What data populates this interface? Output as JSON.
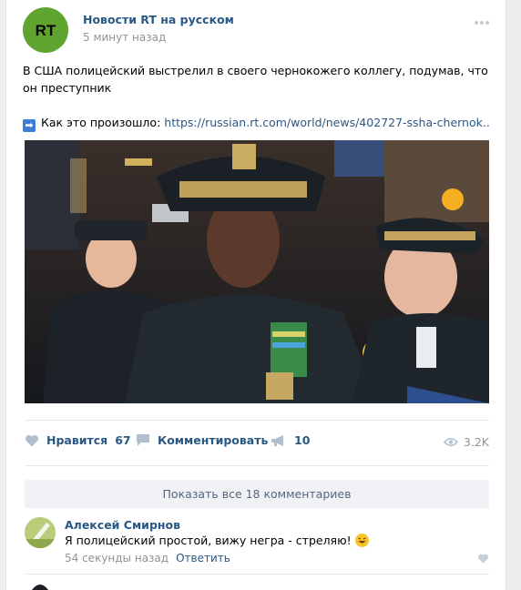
{
  "post": {
    "group_name": "Новости RT на русском",
    "time": "5 минут назад",
    "avatar_text": "RT",
    "text": "В США полицейский выстрелил в своего чернокожего коллегу, подумав, что он преступник",
    "link_prefix": "Как это произошло:",
    "link_url": "https://russian.rt.com/world/news/402727-ssha-chernok..",
    "photo_icon": "photo-police-officers"
  },
  "actions": {
    "like_label": "Нравится",
    "like_count": "67",
    "comment_label": "Комментировать",
    "share_count": "10",
    "views": "3.2K"
  },
  "comments": {
    "show_all_label": "Показать все 18 комментариев",
    "items": [
      {
        "author": "Алексей Смирнов",
        "text": "Я полицейский простой, вижу негра - стреляю!",
        "time": "54 секунды назад",
        "reply_label": "Ответить"
      }
    ]
  },
  "colors": {
    "link": "#2a5885",
    "meta": "#939393",
    "rt_green": "#5fa42f",
    "background": "#edeef0"
  }
}
